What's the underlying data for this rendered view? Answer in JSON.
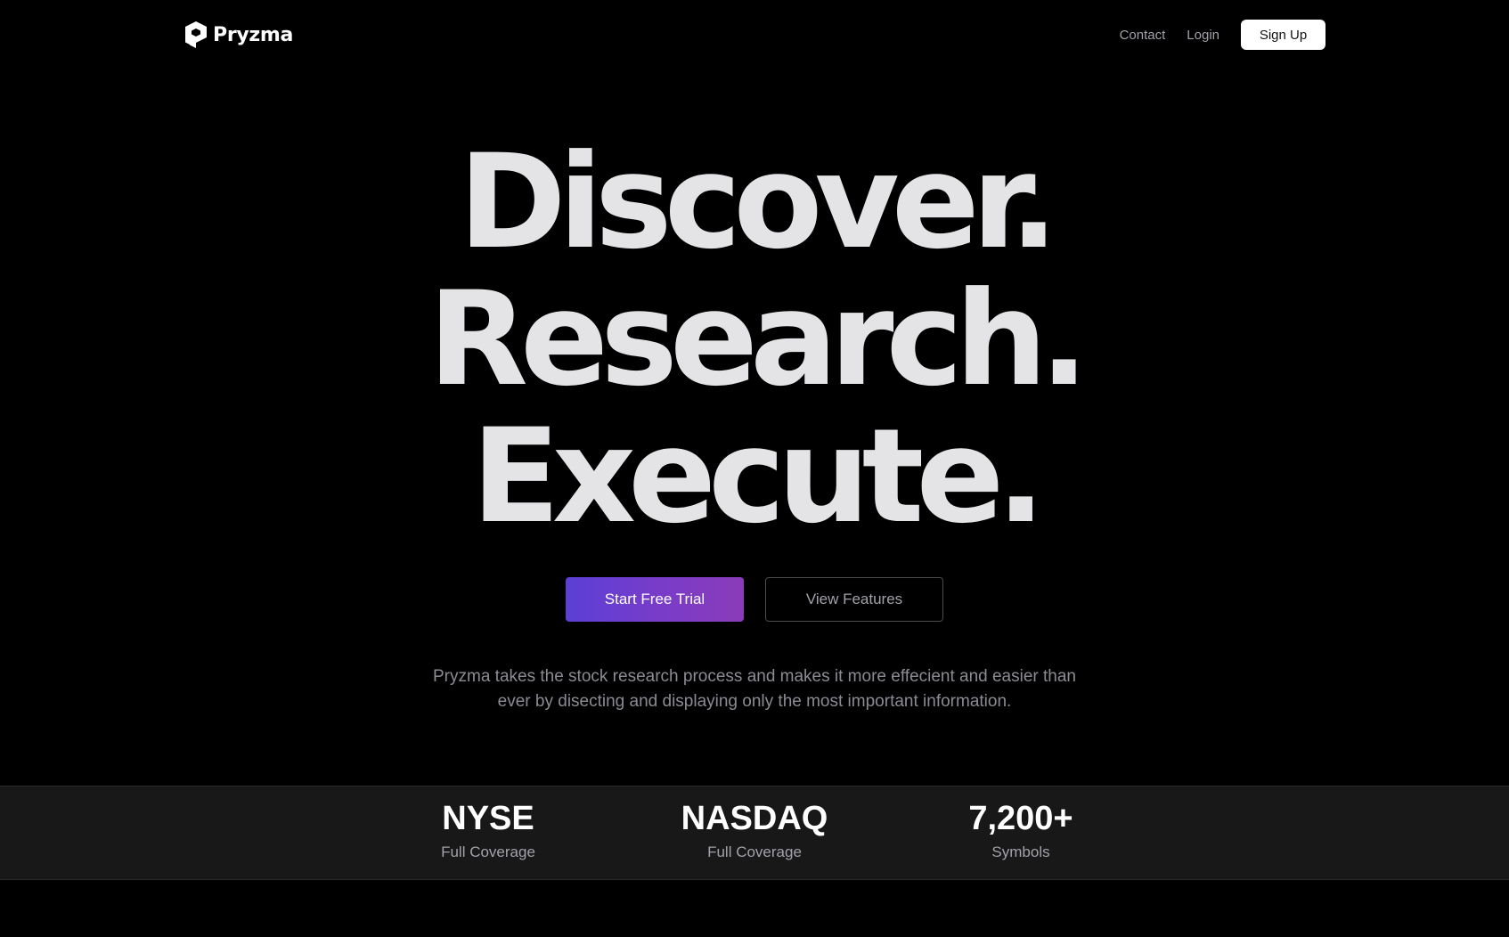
{
  "nav": {
    "brand_name": "Pryzma",
    "links": [
      "Contact",
      "Login"
    ],
    "signup_label": "Sign Up"
  },
  "hero": {
    "lines": [
      "Discover.",
      "Research.",
      "Execute."
    ],
    "primary_cta": "Start Free Trial",
    "secondary_cta": "View Features",
    "tagline_lines": [
      "Pryzma takes the stock research process and makes it more effecient and easier than",
      "ever by disecting and displaying only the most important information."
    ]
  },
  "stats": [
    {
      "value": "NYSE",
      "label": "Full Coverage"
    },
    {
      "value": "NASDAQ",
      "label": "Full Coverage"
    },
    {
      "value": "7,200+",
      "label": "Symbols"
    }
  ],
  "colors": {
    "background": "#000000",
    "headline": "#e4e4e7",
    "accent_start": "#5b3fd6",
    "accent_end": "#8a3cb8",
    "stats_band": "#181818"
  },
  "icons": {
    "logo": "pryzma-logo-icon"
  }
}
